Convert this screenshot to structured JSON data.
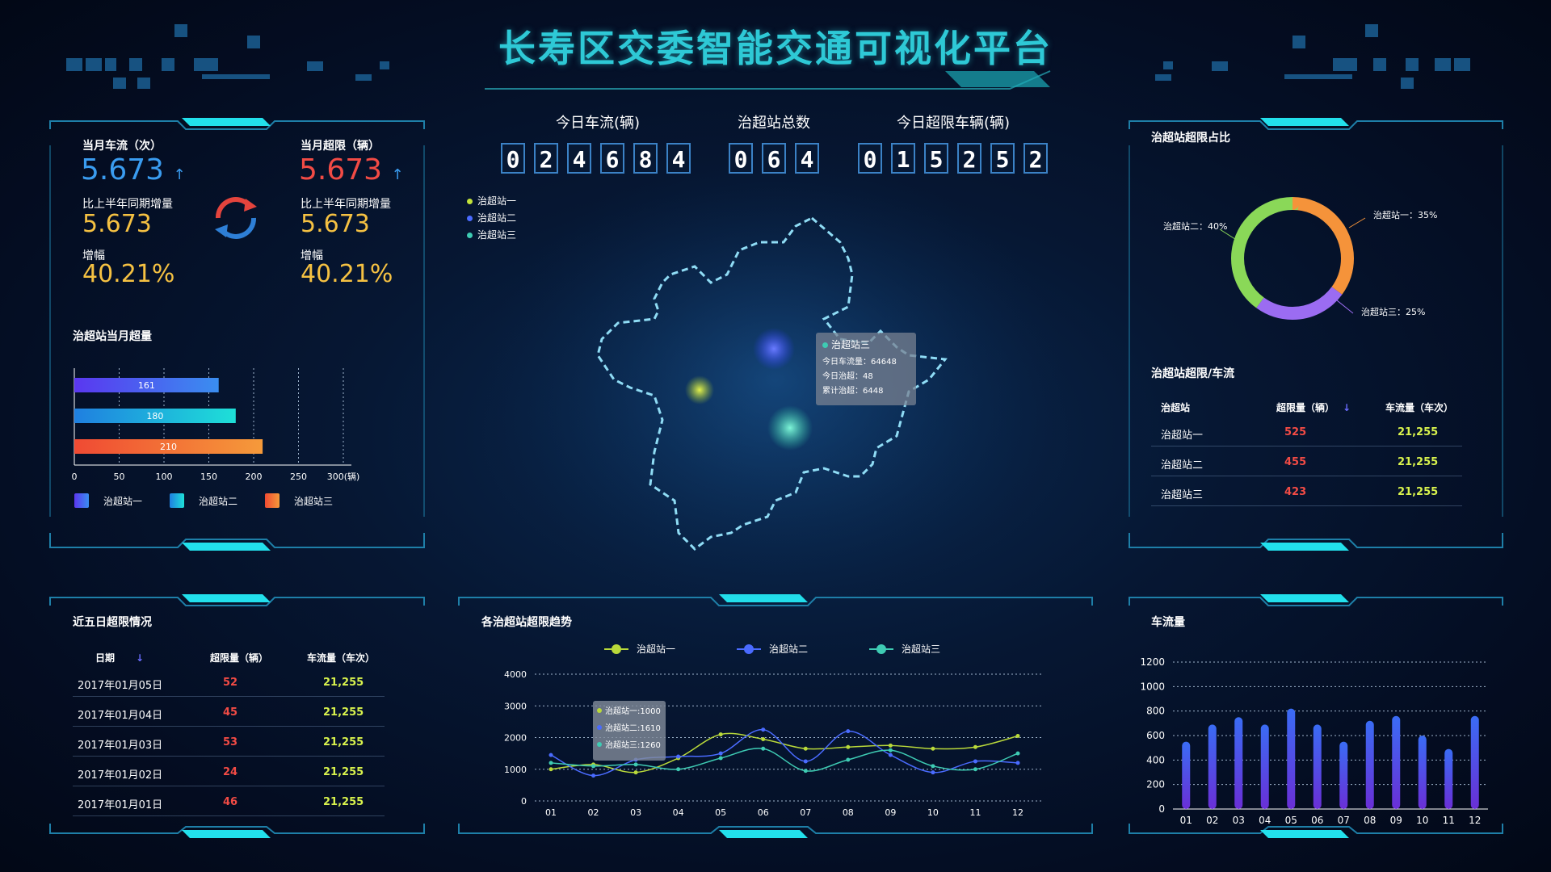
{
  "title": "长寿区交委智能交通可视化平台",
  "title_arrows": "<<<<",
  "colors": {
    "accent": "#2ec9d6",
    "frame": "#1e7fa8",
    "red": "#f24b45",
    "yellow": "#d8f24d",
    "orange": "#f5c142"
  },
  "stats": {
    "month_flow_label": "当月车流（次）",
    "month_flow_value": "5.673",
    "month_over_label": "当月超限（辆）",
    "month_over_value": "5.673",
    "yoy_label": "比上半年同期增量",
    "yoy_value_left": "5.673",
    "yoy_value_right": "5.673",
    "growth_label": "增幅",
    "growth_left": "40.21%",
    "growth_right": "40.21%",
    "up_arrow": "↑"
  },
  "counters": [
    {
      "label": "今日车流(辆)",
      "digits": [
        "0",
        "2",
        "4",
        "6",
        "8",
        "4"
      ]
    },
    {
      "label": "治超站总数",
      "digits": [
        "0",
        "6",
        "4"
      ]
    },
    {
      "label": "今日超限车辆(辆)",
      "digits": [
        "0",
        "1",
        "5",
        "2",
        "5",
        "2"
      ]
    }
  ],
  "map": {
    "legend": [
      "治超站一",
      "治超站二",
      "治超站三"
    ],
    "legend_colors": [
      "#c3e33a",
      "#4a6bff",
      "#3ecbb3"
    ],
    "tooltip": {
      "name": "治超站三",
      "lines": [
        "今日车流量：64648",
        "今日治超：48",
        "累计治超：6448"
      ]
    }
  },
  "right_table": {
    "title": "治超站超限/车流",
    "headers": [
      "治超站",
      "超限量（辆）",
      "车流量（车次）"
    ],
    "sort_icon": "↓",
    "rows": [
      [
        "治超站一",
        "525",
        "21,255"
      ],
      [
        "治超站二",
        "455",
        "21,255"
      ],
      [
        "治超站三",
        "423",
        "21,255"
      ]
    ]
  },
  "five_day": {
    "title": "近五日超限情况",
    "headers": [
      "日期",
      "超限量（辆）",
      "车流量（车次）"
    ],
    "sort_icon": "↓",
    "rows": [
      [
        "2017年01月05日",
        "52",
        "21,255"
      ],
      [
        "2017年01月04日",
        "45",
        "21,255"
      ],
      [
        "2017年01月03日",
        "53",
        "21,255"
      ],
      [
        "2017年01月02日",
        "24",
        "21,255"
      ],
      [
        "2017年01月01日",
        "46",
        "21,255"
      ]
    ]
  },
  "chart_data": [
    {
      "id": "hbar",
      "type": "bar",
      "orientation": "horizontal",
      "title": "治超站当月超量",
      "categories": [
        "治超站一",
        "治超站二",
        "治超站三"
      ],
      "values": [
        161,
        180,
        210
      ],
      "xlim": [
        0,
        300
      ],
      "xticks": [
        "0",
        "50",
        "100",
        "150",
        "200",
        "250",
        "300(辆)"
      ],
      "grid": true,
      "legend": "bottom",
      "colors": [
        [
          "#5a37f0",
          "#3a8ef0"
        ],
        [
          "#1f7fe0",
          "#1ee0d8"
        ],
        [
          "#f04a33",
          "#f59a3a"
        ]
      ]
    },
    {
      "id": "donut",
      "type": "pie",
      "title": "治超站超限占比",
      "slices": [
        {
          "name": "治超站一",
          "value": 35,
          "label": "治超站一：35%",
          "color": "#f5933a"
        },
        {
          "name": "治超站三",
          "value": 25,
          "label": "治超站三：25%",
          "color": "#9b6cf2"
        },
        {
          "name": "治超站二",
          "value": 40,
          "label": "治超站二：40%",
          "color": "#8ad858"
        }
      ]
    },
    {
      "id": "trend",
      "type": "line",
      "title": "各治超站超限趋势",
      "categories": [
        "01",
        "02",
        "03",
        "04",
        "05",
        "06",
        "07",
        "08",
        "09",
        "10",
        "11",
        "12"
      ],
      "ylim": [
        0,
        4000
      ],
      "yticks": [
        0,
        1000,
        2000,
        3000,
        4000
      ],
      "legend": "top",
      "series": [
        {
          "name": "治超站一",
          "color": "#b9d93a",
          "values": [
            1000,
            1150,
            900,
            1350,
            2100,
            1950,
            1650,
            1700,
            1750,
            1650,
            1700,
            2050
          ]
        },
        {
          "name": "治超站二",
          "color": "#4a6bff",
          "values": [
            1450,
            800,
            1300,
            1400,
            1500,
            2250,
            1250,
            2200,
            1450,
            900,
            1250,
            1200
          ]
        },
        {
          "name": "治超站三",
          "color": "#3ecbb3",
          "values": [
            1200,
            1100,
            1150,
            1000,
            1350,
            1650,
            950,
            1300,
            1600,
            1100,
            1000,
            1500
          ]
        }
      ],
      "tooltip": [
        "治超站一:1000",
        "治超站二:1610",
        "治超站三:1260"
      ]
    },
    {
      "id": "vbar",
      "type": "bar",
      "title": "车流量",
      "categories": [
        "01",
        "02",
        "03",
        "04",
        "05",
        "06",
        "07",
        "08",
        "09",
        "10",
        "11",
        "12"
      ],
      "values": [
        550,
        690,
        750,
        690,
        820,
        690,
        550,
        720,
        760,
        600,
        490,
        760
      ],
      "ylim": [
        0,
        1200
      ],
      "yticks": [
        0,
        200,
        400,
        600,
        800,
        1000,
        1200
      ],
      "grid": true,
      "colors": [
        "#3a6cf5",
        "#6a2fd6"
      ]
    }
  ]
}
